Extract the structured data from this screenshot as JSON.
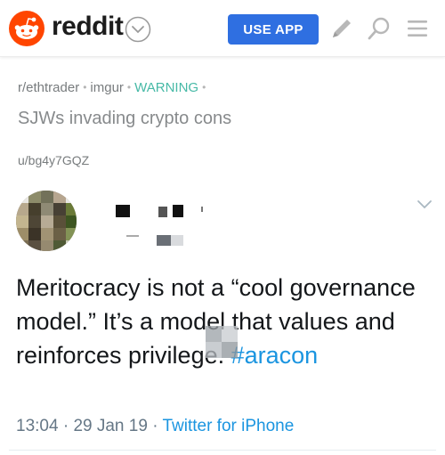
{
  "header": {
    "app_name": "reddit",
    "use_app_label": "USE APP",
    "brand_color": "#ff4500",
    "button_color": "#2f6fe1",
    "icons": [
      "reddit-logo-icon",
      "chevron-down-icon",
      "pencil-icon",
      "search-icon",
      "hamburger-menu-icon"
    ]
  },
  "post": {
    "subreddit": "r/ethtrader",
    "domain": "imgur",
    "flair": "WARNING",
    "flair_color": "#46b9a6",
    "title": "SJWs invading crypto cons",
    "author": "u/bg4y7GQZ"
  },
  "tweet": {
    "text_before": "Meritocracy is not a “cool governance model.” It’s a model that values and reinforces privilege. ",
    "hashtag": "#aracon",
    "time": "13:04",
    "date": "29 Jan 19",
    "source": "Twitter for iPhone",
    "separator": "·",
    "link_color": "#1b95e0",
    "icons": [
      "chevron-down-icon"
    ]
  }
}
